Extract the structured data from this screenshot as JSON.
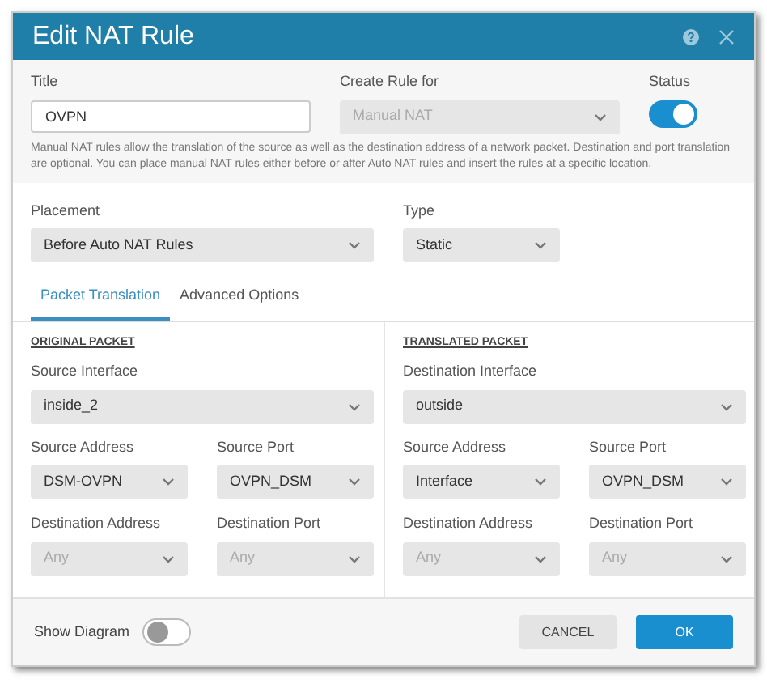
{
  "window": {
    "title": "Edit NAT Rule"
  },
  "title_field": {
    "label": "Title",
    "value": "OVPN"
  },
  "create_rule_for": {
    "label": "Create Rule for",
    "value": "Manual NAT",
    "disabled": true
  },
  "status": {
    "label": "Status",
    "on": true
  },
  "description": "Manual NAT rules allow the translation of the source as well as the destination address of a network packet. Destination and port translation are optional. You can place manual NAT rules either before or after Auto NAT rules and insert the rules at a specific location.",
  "placement": {
    "label": "Placement",
    "value": "Before Auto NAT Rules",
    "disabled": false
  },
  "type": {
    "label": "Type",
    "value": "Static",
    "disabled": false
  },
  "tabs": [
    {
      "label": "Packet Translation",
      "selected": true
    },
    {
      "label": "Advanced Options",
      "selected": false
    }
  ],
  "sections": [
    {
      "heading": "ORIGINAL PACKET",
      "interface": {
        "label": "Source Interface",
        "value": "inside_2",
        "disabled": false
      },
      "fields": [
        {
          "label": "Source Address",
          "value": "DSM-OVPN",
          "disabled": false
        },
        {
          "label": "Source Port",
          "value": "OVPN_DSM",
          "disabled": false
        },
        {
          "label": "Destination Address",
          "value": "Any",
          "disabled": true
        },
        {
          "label": "Destination Port",
          "value": "Any",
          "disabled": true
        }
      ]
    },
    {
      "heading": "TRANSLATED PACKET",
      "interface": {
        "label": "Destination Interface",
        "value": "outside",
        "disabled": false
      },
      "fields": [
        {
          "label": "Source Address",
          "value": "Interface",
          "disabled": false
        },
        {
          "label": "Source Port",
          "value": "OVPN_DSM",
          "disabled": false
        },
        {
          "label": "Destination Address",
          "value": "Any",
          "disabled": true
        },
        {
          "label": "Destination Port",
          "value": "Any",
          "disabled": true
        }
      ]
    }
  ],
  "show_diagram": {
    "label": "Show Diagram",
    "on": false
  },
  "buttons": [
    {
      "label": "CANCEL",
      "kind": "secondary"
    },
    {
      "label": "OK",
      "kind": "primary"
    }
  ]
}
